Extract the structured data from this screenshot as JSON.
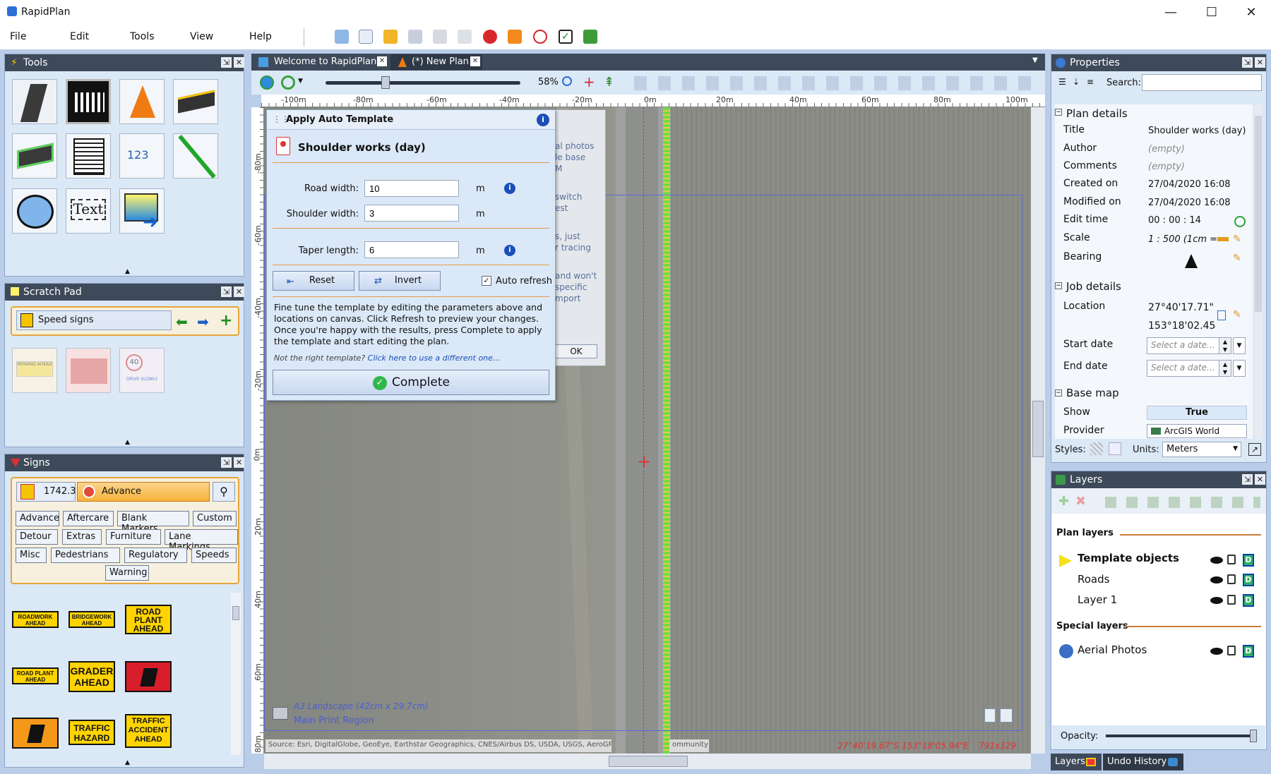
{
  "app": {
    "title": "RapidPlan"
  },
  "menu": [
    "File",
    "Edit",
    "Tools",
    "View",
    "Help"
  ],
  "tools_panel": {
    "title": "Tools",
    "text_tool": "Text"
  },
  "scratch_pad": {
    "title": "Scratch Pad",
    "selector": "Speed signs",
    "sign1": "MOWING AHEAD",
    "sign3_top": "40",
    "sign3_bottom": "DRIVE SLOWLY"
  },
  "signs_panel": {
    "title": "Signs",
    "count": "1742.3",
    "category": "Advance",
    "tags": [
      "Advance",
      "Aftercare",
      "Blank Markers",
      "Custom",
      "Detour",
      "Extras",
      "Furniture",
      "Lane Markings",
      "Misc",
      "Pedestrians",
      "Regulatory",
      "Speeds",
      "Warning"
    ],
    "signs": [
      "ROADWORK AHEAD",
      "BRIDGEWORK AHEAD",
      "ROAD PLANT AHEAD",
      "ROAD PLANT AHEAD",
      "GRADER AHEAD",
      "",
      "",
      "TRAFFIC HAZARD",
      "TRAFFIC ACCIDENT AHEAD"
    ]
  },
  "doc_tabs": [
    {
      "label": "Welcome to RapidPlan"
    },
    {
      "label": "(*) New Plan"
    }
  ],
  "canvas": {
    "zoom": "58%",
    "ruler_top": [
      "-100m",
      "-80m",
      "-60m",
      "-40m",
      "-20m",
      "0m",
      "20m",
      "40m",
      "60m",
      "80m",
      "100m"
    ],
    "ruler_left": [
      "-80m",
      "-60m",
      "-40m",
      "-20m",
      "0m",
      "20m",
      "40m",
      "60m",
      "80m"
    ],
    "print_region_size": "A3 Landscape (42cm x 29.7cm)",
    "print_region_name": "Main Print Region",
    "attribution": "Source: Esri, DigitalGlobe, GeoEye, Earthstar Geographics, CNES/Airbus DS, USDA, USGS, AeroGRID, IGN, a",
    "attribution_tail": "ommunity",
    "coords": "27°40'19.67\"S 153°18'05.94\"E",
    "pixel_size": "791x329"
  },
  "welcome_fragments": [
    "al photos",
    "le base",
    "M",
    "switch",
    "est",
    "s, just",
    "r tracing",
    "and won't",
    "specific",
    "mport"
  ],
  "welcome_ok": "OK",
  "dialog": {
    "title": "Apply Auto Template",
    "template_name": "Shoulder works (day)",
    "road_width_label": "Road width:",
    "road_width": "10",
    "shoulder_width_label": "Shoulder width:",
    "shoulder_width": "3",
    "taper_length_label": "Taper length:",
    "taper_length": "6",
    "unit": "m",
    "reset": "Reset",
    "invert": "Invert",
    "auto_refresh": "Auto refresh",
    "help": "Fine tune the template by editing the parameters above and locations on canvas. Click Refresh to preview your changes. Once you're happy with the results, press Complete to apply the template and start editing the plan.",
    "not_right_prefix": "Not the right template? ",
    "not_right_link": "Click here to use a different one...",
    "complete": "Complete"
  },
  "properties": {
    "title": "Properties",
    "search_label": "Search:",
    "plan_details": "Plan details",
    "rows": [
      {
        "label": "Title",
        "value": "Shoulder works (day)"
      },
      {
        "label": "Author",
        "value": "(empty)"
      },
      {
        "label": "Comments",
        "value": "(empty)"
      },
      {
        "label": "Created on",
        "value": "27/04/2020 16:08"
      },
      {
        "label": "Modified on",
        "value": "27/04/2020 16:08"
      },
      {
        "label": "Edit time",
        "value": "00 : 00 : 14"
      },
      {
        "label": "Scale",
        "value": "1 : 500   (1cm ="
      },
      {
        "label": "Bearing",
        "value": ""
      }
    ],
    "job_details": "Job details",
    "location_label": "Location",
    "location_lat": "27°40'17.71\"",
    "location_lon": "153°18'02.45",
    "start_date_label": "Start date",
    "end_date_label": "End date",
    "date_placeholder": "Select a date...",
    "base_map": "Base map",
    "show_label": "Show",
    "show_value": "True",
    "provider_label": "Provider",
    "provider_value": "ArcGIS World",
    "styles_label": "Styles:",
    "units_label": "Units:",
    "units_value": "Meters"
  },
  "layers": {
    "title": "Layers",
    "plan_layers": "Plan layers",
    "items": [
      "Template objects",
      "Roads",
      "Layer 1"
    ],
    "special_layers": "Special layers",
    "special_items": [
      "Aerial Photos"
    ],
    "opacity_label": "Opacity:",
    "opacity": 1.0,
    "bottom_tabs": [
      "Layers",
      "Undo History"
    ]
  },
  "colors": {
    "panel_head": "#3e4a5a",
    "workspace": "#b9cde8",
    "dialog_bg": "#dbe8f7",
    "accent_orange": "#f6b23a"
  }
}
